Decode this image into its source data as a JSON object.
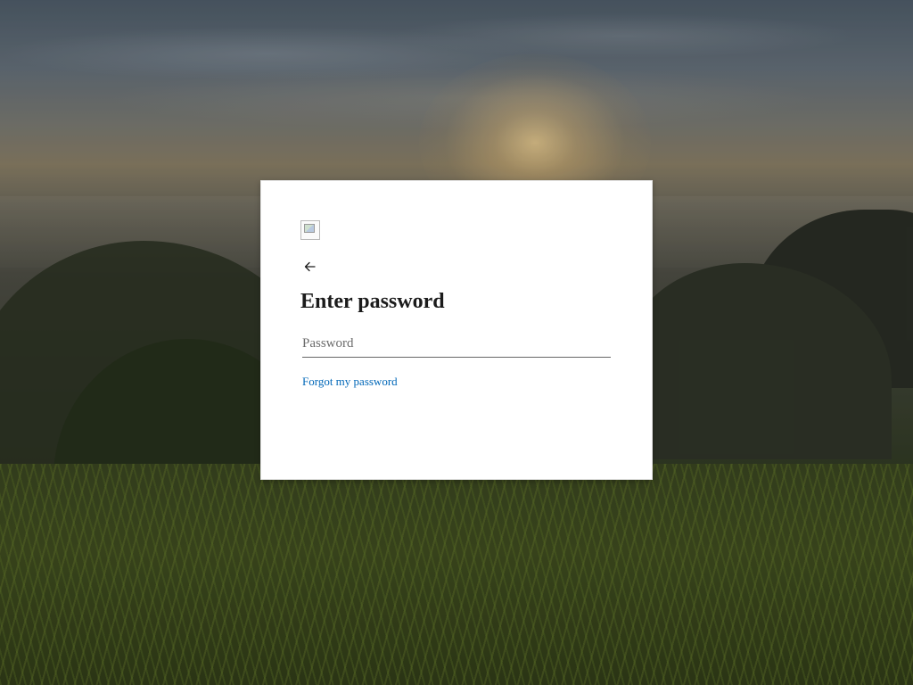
{
  "background": {
    "description_colors": {
      "sky": "#5b6672",
      "sun": "#f2d28a",
      "grass": "#3f4c1f"
    }
  },
  "signin_card": {
    "logo_icon": "broken-image-icon",
    "back_icon": "arrow-left-icon",
    "title": "Enter password",
    "password_placeholder": "Password",
    "password_value": "",
    "forgot_link": "Forgot my password",
    "link_color": "#0067b8"
  }
}
